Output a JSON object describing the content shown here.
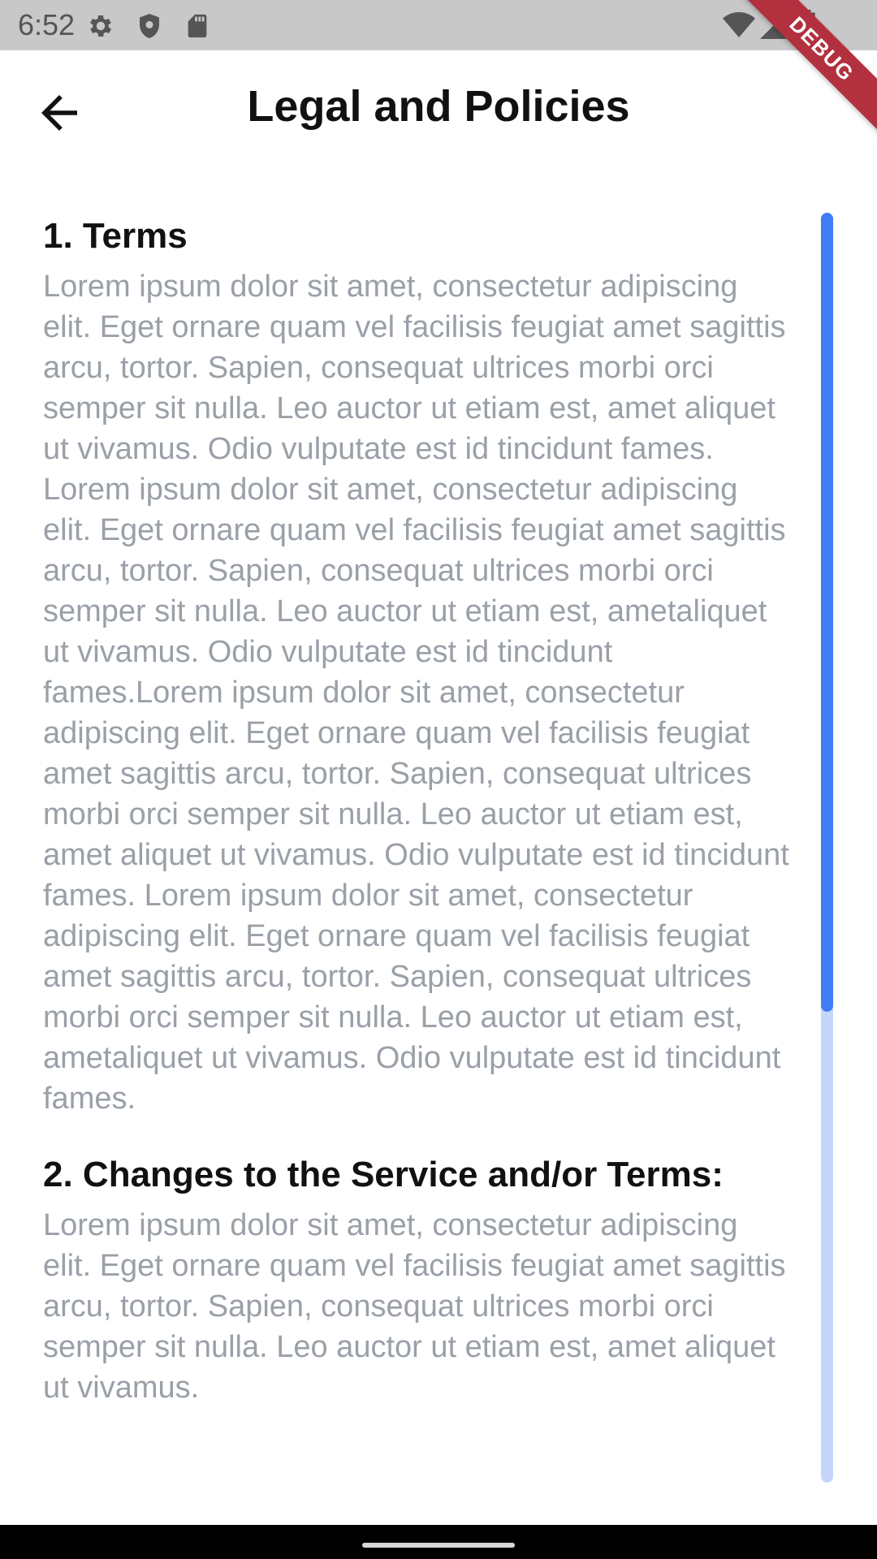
{
  "status_bar": {
    "time": "6:52",
    "left_icons": [
      "settings-icon",
      "shield-icon",
      "sd-card-icon"
    ],
    "right_icons": [
      "wifi-icon",
      "signal-icon",
      "battery-icon"
    ]
  },
  "debug_banner": {
    "label": "DEBUG",
    "color": "#b3313f"
  },
  "app_bar": {
    "back_icon": "arrow-back-icon",
    "title": "Legal and Policies"
  },
  "sections": [
    {
      "title": "1. Terms",
      "body": "Lorem ipsum dolor sit amet, consectetur adipiscing elit. Eget ornare quam vel facilisis feugiat amet sagittis arcu, tortor. Sapien, consequat ultrices morbi orci semper sit nulla. Leo auctor ut etiam est, amet aliquet ut vivamus. Odio vulputate est id tincidunt fames. Lorem ipsum dolor sit amet, consectetur adipiscing elit. Eget ornare quam vel facilisis feugiat amet sagittis arcu, tortor. Sapien, consequat ultrices morbi orci semper sit nulla. Leo auctor ut etiam est, ametaliquet ut vivamus. Odio vulputate est id tincidunt fames.Lorem ipsum dolor sit amet, consectetur adipiscing elit. Eget ornare quam vel facilisis feugiat amet sagittis arcu, tortor. Sapien, consequat ultrices morbi orci semper sit nulla. Leo auctor ut etiam est, amet aliquet ut vivamus. Odio vulputate est id tincidunt fames. Lorem ipsum dolor sit amet, consectetur adipiscing elit. Eget ornare quam vel facilisis feugiat amet sagittis arcu, tortor. Sapien, consequat ultrices morbi orci semper sit nulla. Leo auctor ut etiam est, ametaliquet ut vivamus. Odio vulputate est id tincidunt fames."
    },
    {
      "title": "2. Changes to the Service and/or Terms:",
      "body": "Lorem ipsum dolor sit amet, consectetur adipiscing elit. Eget ornare quam vel facilisis feugiat amet sagittis arcu, tortor. Sapien, consequat ultrices morbi orci semper sit nulla. Leo auctor ut etiam est, amet aliquet ut vivamus."
    }
  ],
  "colors": {
    "scroll_thumb": "#3f7cf6",
    "scroll_track": "#c6d6fb",
    "body_text": "#9aa0a8",
    "heading_text": "#111111"
  }
}
